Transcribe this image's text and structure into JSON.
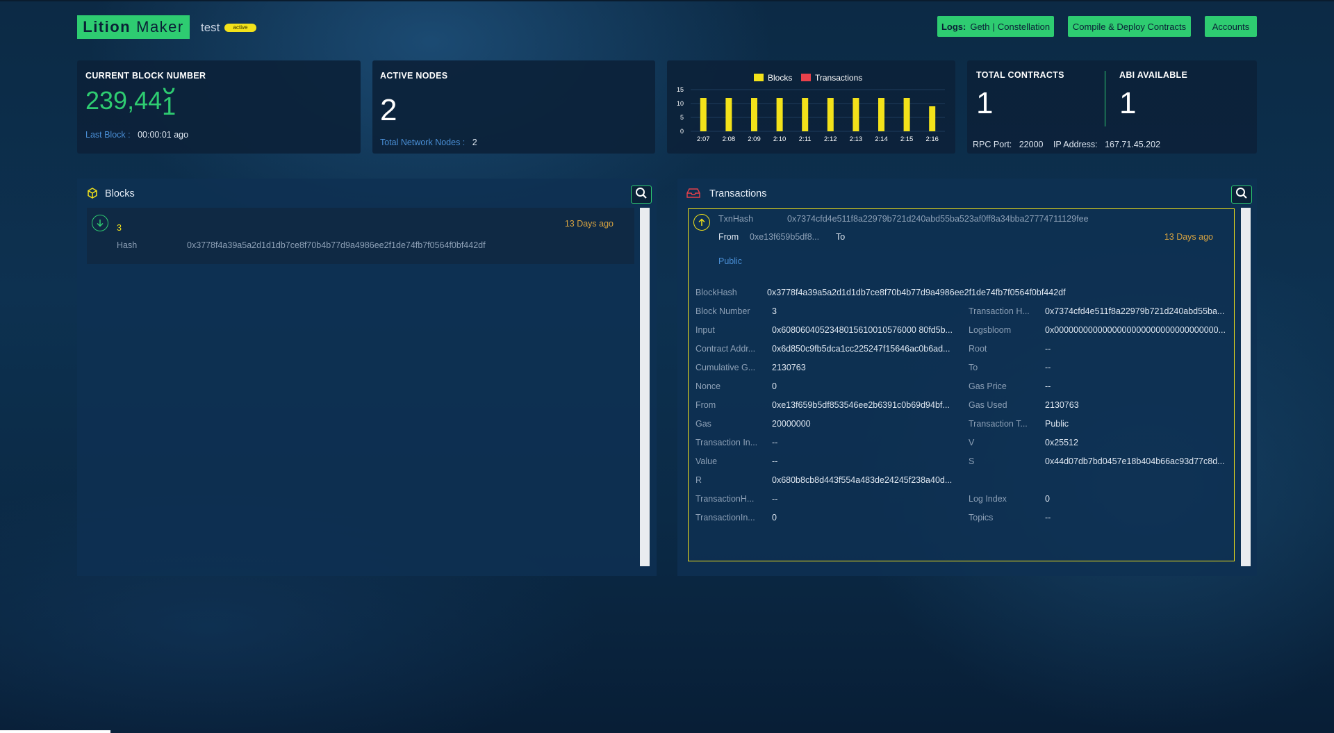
{
  "header": {
    "logo_bold": "Litio n",
    "logo_bold_text": "Lition",
    "logo_light": "Maker",
    "network_name": "test",
    "network_status": "active",
    "logs_label": "Logs:",
    "logs_geth": "Geth",
    "logs_sep": "|",
    "logs_constellation": "Constellation",
    "compile_label": "Compile & Deploy Contracts",
    "accounts_label": "Accounts"
  },
  "block_card": {
    "title": "CURRENT BLOCK NUMBER",
    "number_main": "239,44",
    "number_tail": "1",
    "number_flip": "0",
    "last_block_label": "Last Block :",
    "last_block_value": "00:00:01 ago"
  },
  "nodes_card": {
    "title": "ACTIVE NODES",
    "count": "2",
    "total_label": "Total Network Nodes :",
    "total_value": "2"
  },
  "chart_data": {
    "type": "bar",
    "categories": [
      "2:07",
      "2:08",
      "2:09",
      "2:10",
      "2:11",
      "2:12",
      "2:13",
      "2:14",
      "2:15",
      "2:16"
    ],
    "series": [
      {
        "name": "Blocks",
        "values": [
          12,
          12,
          12,
          12,
          12,
          12,
          12,
          12,
          12,
          9
        ],
        "color": "#f3e21a"
      },
      {
        "name": "Transactions",
        "values": [
          0,
          0,
          0,
          0,
          0,
          0,
          0,
          0,
          0,
          0
        ],
        "color": "#e8414b"
      }
    ],
    "yticks": [
      "15",
      "10",
      "5",
      "0"
    ],
    "ylim": [
      0,
      15
    ],
    "legend": "top-center",
    "grid": true
  },
  "contracts_card": {
    "total_title": "TOTAL CONTRACTS",
    "total_value": "1",
    "abi_title": "ABI AVAILABLE",
    "abi_value": "1",
    "rpc_label": "RPC Port:",
    "rpc_value": "22000",
    "ip_label": "IP Address:",
    "ip_value": "167.71.45.202"
  },
  "blocks_panel": {
    "title": "Blocks",
    "items": [
      {
        "number": "3",
        "age": "13 Days ago",
        "hash_label": "Hash",
        "hash": "0x3778f4a39a5a2d1d1db7ce8f70b4b77d9a4986ee2f1de74fb7f0564f0bf442df"
      }
    ]
  },
  "tx_panel": {
    "title": "Transactions",
    "txn_hash_label": "TxnHash",
    "txn_hash": "0x7374cfd4e511f8a22979b721d240abd55ba523af0ff8a34bba27774711129fee",
    "from_label": "From",
    "from_value": "0xe13f659b5df8...",
    "to_label": "To",
    "age": "13 Days ago",
    "type_value": "Public",
    "block_hash_label": "BlockHash",
    "block_hash": "0x3778f4a39a5a2d1d1db7ce8f70b4b77d9a4986ee2f1de74fb7f0564f0bf442df",
    "left": [
      {
        "k": "Block Number",
        "v": "3"
      },
      {
        "k": "Input",
        "v": "0x6080604052348015610010576000 80fd5b..."
      },
      {
        "k": "Contract Addr...",
        "v": "0x6d850c9fb5dca1cc225247f15646ac0b6ad..."
      },
      {
        "k": "Cumulative G...",
        "v": "2130763"
      },
      {
        "k": "Nonce",
        "v": "0"
      },
      {
        "k": "From",
        "v": "0xe13f659b5df853546ee2b6391c0b69d94bf..."
      },
      {
        "k": "Gas",
        "v": "20000000"
      },
      {
        "k": "Transaction In...",
        "v": "--"
      },
      {
        "k": "Value",
        "v": "--"
      },
      {
        "k": "R",
        "v": "0x680b8cb8d443f554a483de24245f238a40d..."
      },
      {
        "k": "TransactionH...",
        "v": "--"
      },
      {
        "k": "TransactionIn...",
        "v": "0"
      }
    ],
    "right": [
      {
        "k": "Transaction H...",
        "v": "0x7374cfd4e511f8a22979b721d240abd55ba..."
      },
      {
        "k": "Logsbloom",
        "v": "0x0000000000000000000000000000000000..."
      },
      {
        "k": "Root",
        "v": "--"
      },
      {
        "k": "To",
        "v": "--"
      },
      {
        "k": "Gas Price",
        "v": "--"
      },
      {
        "k": "Gas Used",
        "v": "2130763"
      },
      {
        "k": "Transaction T...",
        "v": "Public"
      },
      {
        "k": "V",
        "v": "0x25512"
      },
      {
        "k": "S",
        "v": "0x44d07db7bd0457e18b404b66ac93d77c8d..."
      },
      {
        "k": "",
        "v": ""
      },
      {
        "k": "Log Index",
        "v": "0"
      },
      {
        "k": "Topics",
        "v": "--"
      }
    ]
  }
}
